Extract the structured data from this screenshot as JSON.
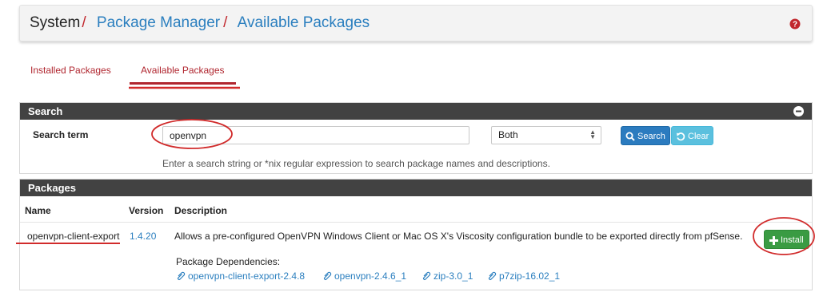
{
  "breadcrumb": {
    "system": "System",
    "separator": "/",
    "package_manager": "Package Manager",
    "available_packages": "Available Packages"
  },
  "help_icon": "question-circle-icon",
  "tabs": [
    {
      "label": "Installed Packages",
      "active": false
    },
    {
      "label": "Available Packages",
      "active": true
    }
  ],
  "search": {
    "title": "Search",
    "term_label": "Search term",
    "term_value": "openvpn",
    "scope_value": "Both",
    "search_button": "Search",
    "clear_button": "Clear",
    "help_text": "Enter a search string or *nix regular expression to search package names and descriptions."
  },
  "packages": {
    "title": "Packages",
    "columns": {
      "name": "Name",
      "version": "Version",
      "description": "Description"
    },
    "rows": [
      {
        "name": "openvpn-client-export",
        "version": "1.4.20",
        "description": "Allows a pre-configured OpenVPN Windows Client or Mac OS X's Viscosity configuration bundle to be exported directly from pfSense.",
        "install_label": "Install",
        "deps_label": "Package Dependencies:",
        "dependencies": [
          "openvpn-client-export-2.4.8",
          "openvpn-2.4.6_1",
          "zip-3.0_1",
          "p7zip-16.02_1"
        ]
      }
    ]
  },
  "colors": {
    "accent_red": "#c1272d",
    "link_blue": "#2b7fbf",
    "panel_header": "#424242",
    "install_green": "#3a9b43",
    "search_blue": "#2b7bbf",
    "clear_cyan": "#5bc0de"
  }
}
